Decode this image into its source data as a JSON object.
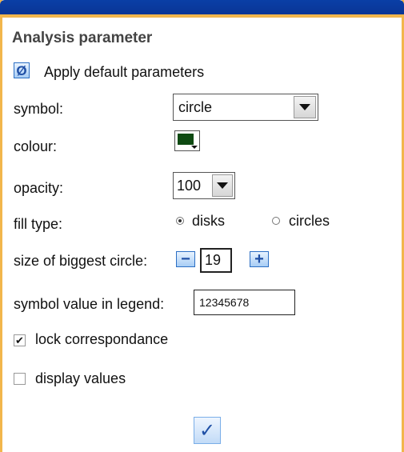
{
  "panel": {
    "title": "Analysis parameter",
    "apply_default": {
      "icon": "reset-icon",
      "glyph": "Ø",
      "label": "Apply default parameters"
    },
    "symbol": {
      "label": "symbol:",
      "value": "circle"
    },
    "colour": {
      "label": "colour:",
      "value": "#0e4a12"
    },
    "opacity": {
      "label": "opacity:",
      "value": "100"
    },
    "fill_type": {
      "label": "fill type:",
      "options": [
        {
          "label": "disks",
          "selected": true
        },
        {
          "label": "circles",
          "selected": false
        }
      ]
    },
    "biggest_circle": {
      "label": "size of biggest circle:",
      "value": "19",
      "minus": "−",
      "plus": "+"
    },
    "legend_value": {
      "label": "symbol value in legend:",
      "value": "12345678"
    },
    "lock": {
      "label": "lock correspondance",
      "checked": true,
      "mark": "✔"
    },
    "display_values": {
      "label": "display values",
      "checked": false
    },
    "ok": {
      "icon": "checkmark-icon",
      "glyph": "✓"
    }
  },
  "colors": {
    "title_bar": "#0a3fa6",
    "border_accent": "#f2b64c",
    "button_blue": "#2c6fc4"
  }
}
